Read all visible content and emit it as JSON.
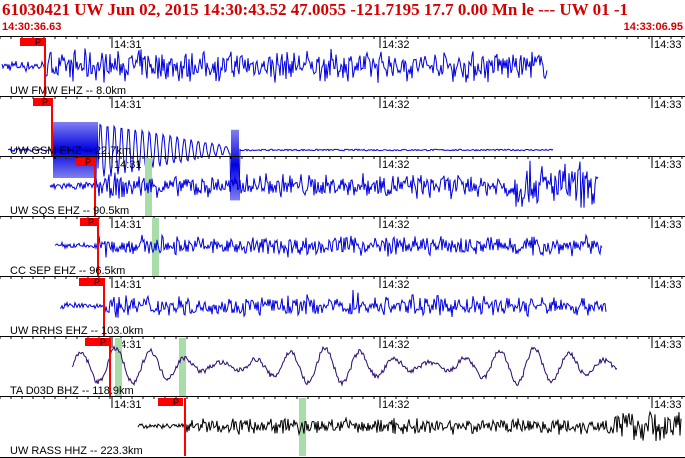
{
  "header": {
    "title": "61030421 UW Jun 02, 2015 14:30:43.52   47.0055 -121.7195 17.7 0.00 Mn le --- UW 01  -1",
    "start_time": "14:30:36.63",
    "end_time": "14:33:06.95"
  },
  "colors": {
    "header_text": "#d40000",
    "trace_blue": "#0000e0",
    "trace_purple": "#2a0a6a",
    "trace_black": "#000000",
    "pick_box": "#ff0000",
    "arrival_marker": "#a8dca8"
  },
  "tick_labels": [
    "14:31",
    "14:32",
    "14:33"
  ],
  "pick_label": "P",
  "traces": [
    {
      "label": "UW FMW EHZ -- 8.0km"
    },
    {
      "label": "UW GSM EHZ -- 22.7km"
    },
    {
      "label": "UW SQS EHZ -- 90.5km"
    },
    {
      "label": "CC SEP EHZ -- 96.5km"
    },
    {
      "label": "UW RRHS EHZ -- 103.0km"
    },
    {
      "label": "TA D03D BHZ -- 118.9km"
    },
    {
      "label": "UW RASS HHZ -- 223.3km"
    }
  ]
}
